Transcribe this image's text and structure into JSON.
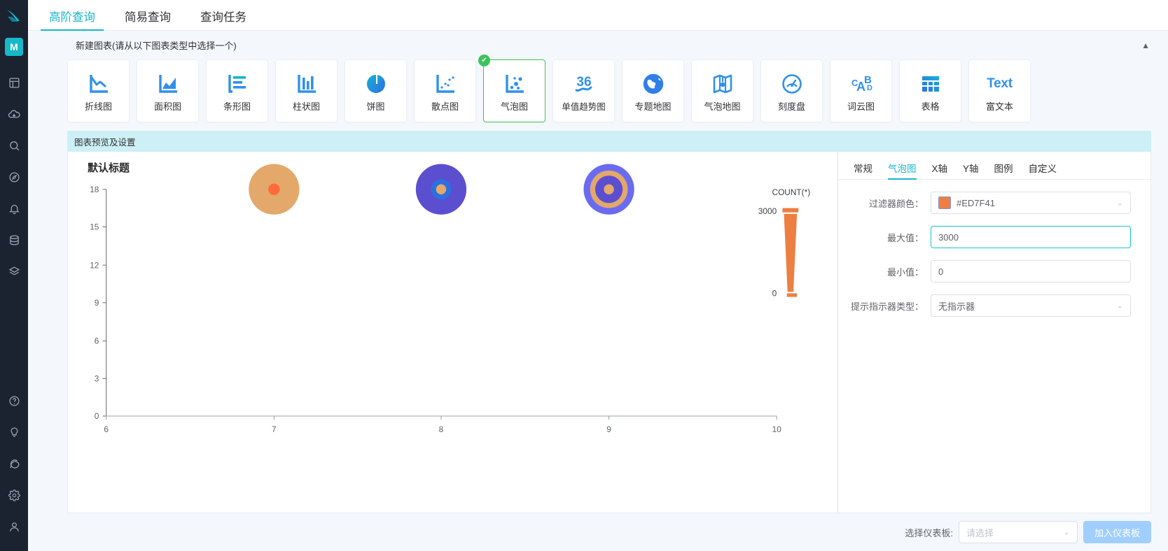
{
  "rail": {
    "avatar_initial": "M",
    "icons": [
      {
        "name": "dashboard-icon"
      },
      {
        "name": "cloud-upload-icon"
      },
      {
        "name": "search-icon"
      },
      {
        "name": "compass-icon"
      },
      {
        "name": "bell-icon"
      },
      {
        "name": "database-icon"
      },
      {
        "name": "layers-icon"
      },
      {
        "name": "help-icon"
      },
      {
        "name": "bulb-icon"
      },
      {
        "name": "chat-icon"
      },
      {
        "name": "gear-icon"
      },
      {
        "name": "user-icon"
      }
    ]
  },
  "top_tabs": [
    {
      "label": "高阶查询",
      "active": true
    },
    {
      "label": "简易查询",
      "active": false
    },
    {
      "label": "查询任务",
      "active": false
    }
  ],
  "new_chart": {
    "title": "新建图表(请从以下图表类型中选择一个)",
    "collapse_caret": "▲"
  },
  "chart_types": [
    {
      "label": "折线图",
      "icon": "line-chart-icon",
      "selected": false
    },
    {
      "label": "面积图",
      "icon": "area-chart-icon",
      "selected": false
    },
    {
      "label": "条形图",
      "icon": "bar-chart-icon",
      "selected": false
    },
    {
      "label": "柱状图",
      "icon": "column-chart-icon",
      "selected": false
    },
    {
      "label": "饼图",
      "icon": "pie-chart-icon",
      "selected": false
    },
    {
      "label": "散点图",
      "icon": "scatter-chart-icon",
      "selected": false
    },
    {
      "label": "气泡图",
      "icon": "bubble-chart-icon",
      "selected": true
    },
    {
      "label": "单值趋势图",
      "icon": "single-value-trend-icon",
      "selected": false,
      "glyph": "36"
    },
    {
      "label": "专题地图",
      "icon": "globe-map-icon",
      "selected": false
    },
    {
      "label": "气泡地图",
      "icon": "bubble-map-icon",
      "selected": false
    },
    {
      "label": "刻度盘",
      "icon": "gauge-icon",
      "selected": false
    },
    {
      "label": "词云图",
      "icon": "word-cloud-icon",
      "selected": false
    },
    {
      "label": "表格",
      "icon": "table-icon",
      "selected": false
    },
    {
      "label": "富文本",
      "icon": "rich-text-icon",
      "glyph": "Text",
      "selected": false
    }
  ],
  "preview": {
    "header": "图表预览及设置"
  },
  "chart_data": {
    "type": "scatter",
    "title": "默认标题",
    "xlabel": "",
    "ylabel": "",
    "xlim": [
      6,
      10
    ],
    "ylim": [
      0,
      18
    ],
    "x_ticks": [
      "6",
      "7",
      "8",
      "9",
      "10"
    ],
    "y_ticks": [
      "0",
      "3",
      "6",
      "9",
      "12",
      "15",
      "18"
    ],
    "grid": false,
    "legend": {
      "title": "COUNT(*)",
      "max_label": "3000",
      "min_label": "0",
      "color": "#ED7F41",
      "position": "right"
    },
    "points": [
      {
        "x": 7,
        "y": 18,
        "outer_r": 35,
        "outer_color": "#E3A86A",
        "inner_r": 8,
        "inner_color": "#FF6B3D",
        "rings": 1
      },
      {
        "x": 8,
        "y": 18,
        "outer_r": 35,
        "outer_color": "#5B4FD0",
        "mid_r": 14,
        "mid_color": "#2D6FE0",
        "inner_r": 7,
        "inner_color": "#E3A86A",
        "rings": 2
      },
      {
        "x": 9,
        "y": 18,
        "outer_r": 35,
        "outer_color": "#6A6BF0",
        "mid_r": 25,
        "mid_color": "#E3A86A",
        "mid2_r": 18,
        "mid2_color": "#5B4FD0",
        "inner_r": 7,
        "inner_color": "#E3A86A",
        "rings": 3
      }
    ]
  },
  "settings": {
    "tabs": [
      {
        "label": "常规",
        "active": false
      },
      {
        "label": "气泡图",
        "active": true
      },
      {
        "label": "X轴",
        "active": false
      },
      {
        "label": "Y轴",
        "active": false
      },
      {
        "label": "图例",
        "active": false
      },
      {
        "label": "自定义",
        "active": false
      }
    ],
    "fields": {
      "filter_color": {
        "label": "过滤器颜色：",
        "value": "#ED7F41",
        "swatch": "#ED7F41",
        "caret": "⌄"
      },
      "max_value": {
        "label": "最大值：",
        "value": "3000",
        "focused": true
      },
      "min_value": {
        "label": "最小值：",
        "value": "0",
        "focused": false
      },
      "tooltip_type": {
        "label": "提示指示器类型：",
        "value": "无指示器",
        "caret": "⌄"
      }
    }
  },
  "footer": {
    "dashboard_label": "选择仪表板:",
    "dashboard_placeholder": "请选择",
    "caret": "⌄",
    "add_button": "加入仪表板"
  }
}
